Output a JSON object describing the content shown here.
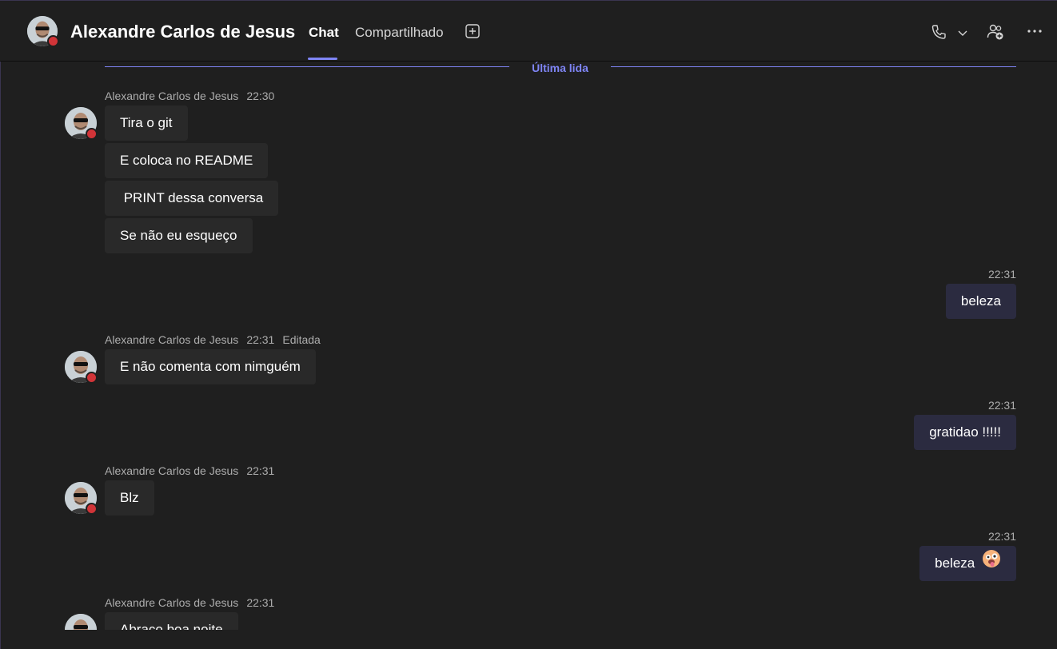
{
  "header": {
    "contact_name": "Alexandre Carlos de Jesus",
    "tabs": [
      {
        "label": "Chat",
        "active": true
      },
      {
        "label": "Compartilhado",
        "active": false
      }
    ],
    "icons": [
      "avatar",
      "add-tab-icon",
      "phone-icon",
      "chevron-down-icon",
      "add-people-icon",
      "more-options-icon"
    ]
  },
  "divider": {
    "label": "Última lida"
  },
  "messages": [
    {
      "sender": "Alexandre Carlos de Jesus",
      "time": "22:30",
      "edited": "",
      "lines": [
        "Tira o git",
        "E coloca no README",
        " PRINT dessa conversa",
        "Se não eu esqueço"
      ]
    },
    {
      "mine": true,
      "time": "22:31",
      "text": "beleza"
    },
    {
      "sender": "Alexandre Carlos de Jesus",
      "time": "22:31",
      "edited": "Editada",
      "lines": [
        "E não comenta com nimguém"
      ]
    },
    {
      "mine": true,
      "time": "22:31",
      "text": "gratidao !!!!!"
    },
    {
      "sender": "Alexandre Carlos de Jesus",
      "time": "22:31",
      "edited": "",
      "lines": [
        "Blz"
      ]
    },
    {
      "mine": true,
      "time": "22:31",
      "text": "beleza",
      "emoji": "zany-face-emoji"
    },
    {
      "sender": "Alexandre Carlos de Jesus",
      "time": "22:31",
      "edited": "",
      "lines": [
        "Abraço boa noite"
      ]
    }
  ],
  "colors": {
    "background": "#1f1f1f",
    "accent": "#7f85f5",
    "incoming_bubble": "#292929",
    "outgoing_bubble": "#2b2b40",
    "presence_busy": "#d13438"
  }
}
